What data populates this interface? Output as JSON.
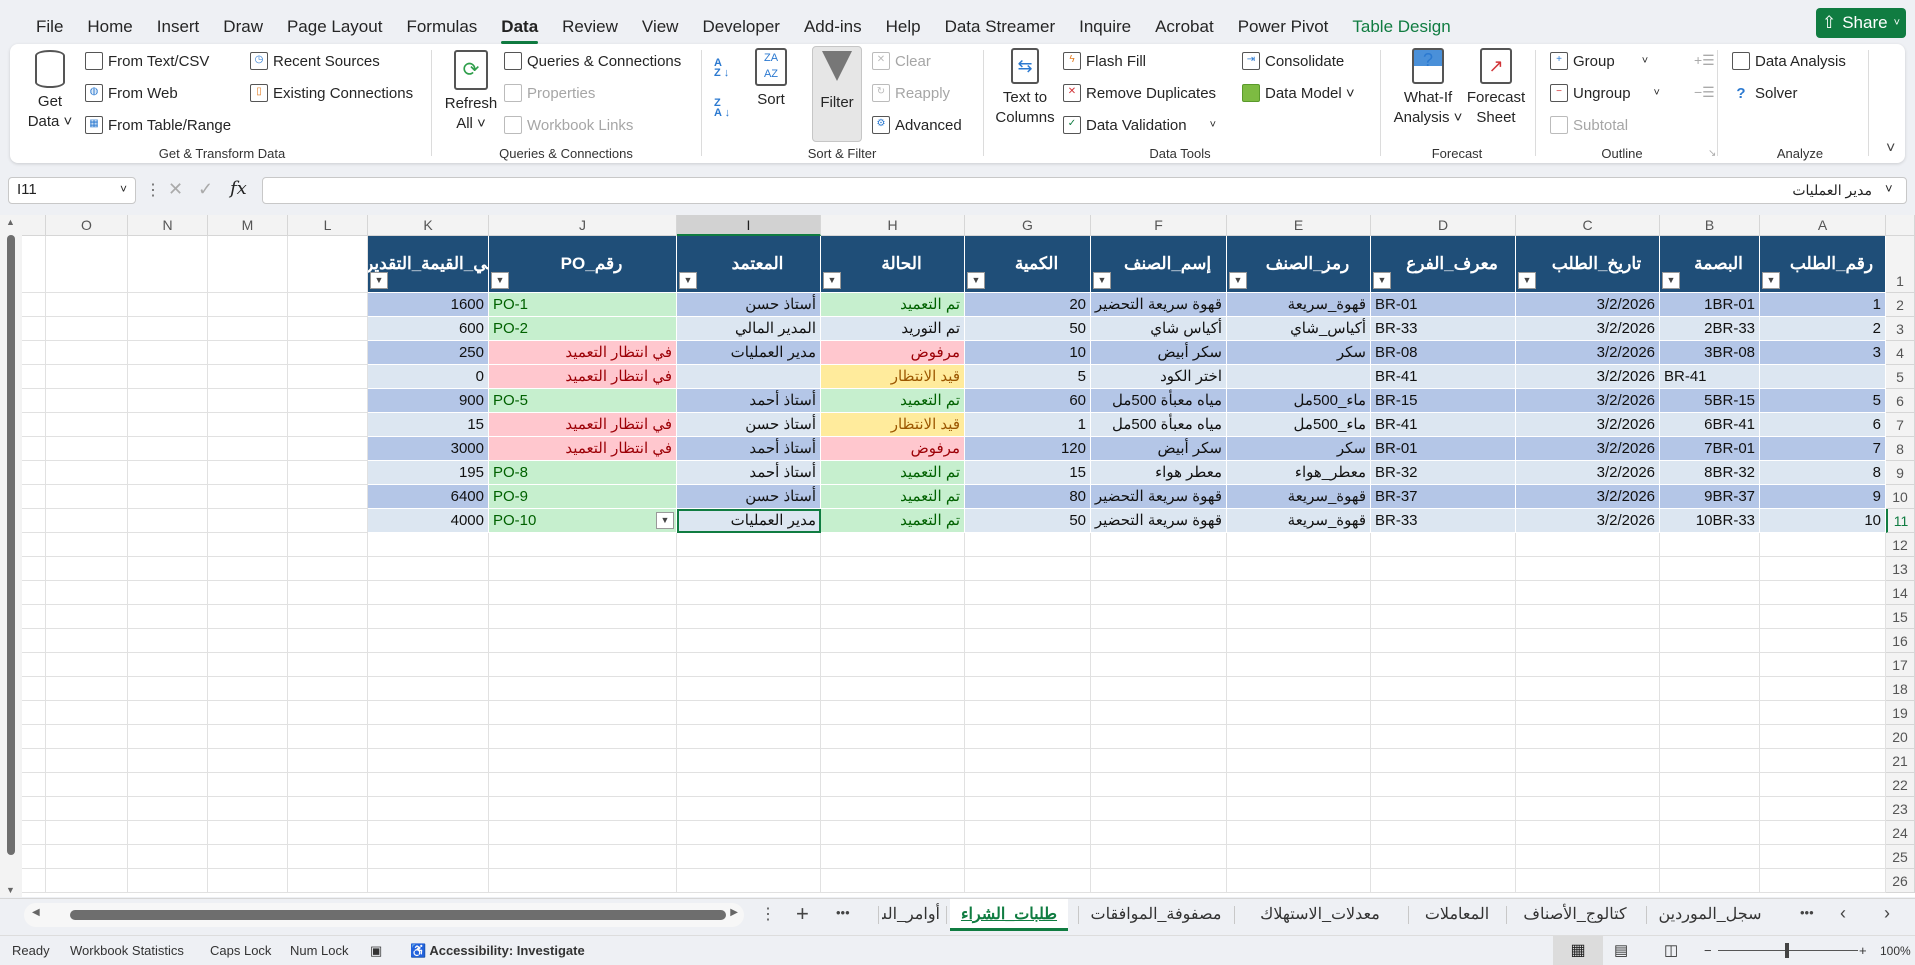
{
  "menu": {
    "tabs": [
      "File",
      "Home",
      "Insert",
      "Draw",
      "Page Layout",
      "Formulas",
      "Data",
      "Review",
      "View",
      "Developer",
      "Add-ins",
      "Help",
      "Data Streamer",
      "Inquire",
      "Acrobat",
      "Power Pivot",
      "Table Design"
    ],
    "active": "Data",
    "share": "Share"
  },
  "ribbon": {
    "get_data": [
      "Get",
      "Data ˅"
    ],
    "from_text": "From Text/CSV",
    "from_web": "From Web",
    "from_table": "From Table/Range",
    "recent_sources": "Recent Sources",
    "existing_connections": "Existing Connections",
    "group_get": "Get & Transform Data",
    "refresh": [
      "Refresh",
      "All ˅"
    ],
    "queries_connections": "Queries & Connections",
    "properties": "Properties",
    "workbook_links": "Workbook Links",
    "group_queries": "Queries & Connections",
    "sort": "Sort",
    "filter": "Filter",
    "clear": "Clear",
    "reapply": "Reapply",
    "advanced": "Advanced",
    "group_sort": "Sort & Filter",
    "text_to_columns": [
      "Text to",
      "Columns"
    ],
    "flash_fill": "Flash Fill",
    "remove_duplicates": "Remove Duplicates",
    "data_validation": "Data Validation",
    "consolidate": "Consolidate",
    "data_model": "Data Model ˅",
    "group_tools": "Data Tools",
    "what_if": [
      "What-If",
      "Analysis ˅"
    ],
    "forecast_sheet": [
      "Forecast",
      "Sheet"
    ],
    "group_forecast": "Forecast",
    "group": "Group",
    "ungroup": "Ungroup",
    "subtotal": "Subtotal",
    "group_outline": "Outline",
    "data_analysis": "Data Analysis",
    "solver": "Solver",
    "group_analyze": "Analyze"
  },
  "formula_bar": {
    "name_box": "I11",
    "value": "مدير العمليات"
  },
  "grid": {
    "columns": [
      "A",
      "B",
      "C",
      "D",
      "E",
      "F",
      "G",
      "H",
      "I",
      "J",
      "K",
      "L",
      "M",
      "N",
      "O"
    ],
    "row_count": 26,
    "selected": "I11"
  },
  "table": {
    "headers": [
      "رقم_الطلب",
      "البصمة",
      "تاريخ_الطلب",
      "معرف_الفرع",
      "رمز_الصنف",
      "إسم_الصنف",
      "الكمية",
      "الحالة",
      "المعتمد",
      "رقم_PO",
      "إجمالي_القيمة_التقديرية"
    ],
    "rows": [
      [
        "1",
        "1BR-01",
        "3/2/2026",
        "BR-01",
        "قهوة_سريعة",
        "قهوة سريعة التحضير",
        "20",
        "تم التعميد",
        "أستاذ حسن",
        "PO-1",
        "1600"
      ],
      [
        "2",
        "2BR-33",
        "3/2/2026",
        "BR-33",
        "أكياس_شاي",
        "أكياس شاي",
        "50",
        "تم التوريد",
        "المدير المالي",
        "PO-2",
        "600"
      ],
      [
        "3",
        "3BR-08",
        "3/2/2026",
        "BR-08",
        "سكر",
        "سكر أبيض",
        "10",
        "مرفوض",
        "مدير العمليات",
        "في انتظار التعميد",
        "250"
      ],
      [
        "",
        "BR-41",
        "3/2/2026",
        "BR-41",
        "",
        "اختر الكود",
        "5",
        "قيد الانتظار",
        "",
        "في انتظار التعميد",
        "0"
      ],
      [
        "5",
        "5BR-15",
        "3/2/2026",
        "BR-15",
        "ماء_500مل",
        "مياه معبأة 500مل",
        "60",
        "تم التعميد",
        "أستاذ أحمد",
        "PO-5",
        "900"
      ],
      [
        "6",
        "6BR-41",
        "3/2/2026",
        "BR-41",
        "ماء_500مل",
        "مياه معبأة 500مل",
        "1",
        "قيد الانتظار",
        "أستاذ حسن",
        "في انتظار التعميد",
        "15"
      ],
      [
        "7",
        "7BR-01",
        "3/2/2026",
        "BR-01",
        "سكر",
        "سكر أبيض",
        "120",
        "مرفوض",
        "أستاذ أحمد",
        "في انتظار التعميد",
        "3000"
      ],
      [
        "8",
        "8BR-32",
        "3/2/2026",
        "BR-32",
        "معطر_هواء",
        "معطر هواء",
        "15",
        "تم التعميد",
        "أستاذ أحمد",
        "PO-8",
        "195"
      ],
      [
        "9",
        "9BR-37",
        "3/2/2026",
        "BR-37",
        "قهوة_سريعة",
        "قهوة سريعة التحضير",
        "80",
        "تم التعميد",
        "أستاذ حسن",
        "PO-9",
        "6400"
      ],
      [
        "10",
        "10BR-33",
        "3/2/2026",
        "BR-33",
        "قهوة_سريعة",
        "قهوة سريعة التحضير",
        "50",
        "تم التعميد",
        "مدير العمليات",
        "PO-10",
        "4000"
      ]
    ],
    "status_formats": {
      "تم التعميد": "good",
      "مرفوض": "bad",
      "قيد الانتظار": "neutral",
      "في انتظار التعميد": "bad"
    },
    "colors": {
      "header": "#1f4e78",
      "good_fill": "#c6efce",
      "bad_fill": "#ffc7ce",
      "neutral_fill": "#ffeb9c",
      "accent": "#107c41"
    }
  },
  "sheet_tabs": {
    "tabs": [
      "سجل_الموردين",
      "كتالوج_الأصناف",
      "المعاملات",
      "معدلات_الاستهلاك",
      "مصفوفة_الموافقات",
      "طلبات_الشراء",
      "أوامر_الش"
    ],
    "active": "طلبات_الشراء",
    "more": "•••",
    "add": "+"
  },
  "status_bar": {
    "ready": "Ready",
    "workbook_statistics": "Workbook Statistics",
    "caps_lock": "Caps Lock",
    "num_lock": "Num Lock",
    "accessibility": "Accessibility: Investigate",
    "zoom": "100%"
  }
}
